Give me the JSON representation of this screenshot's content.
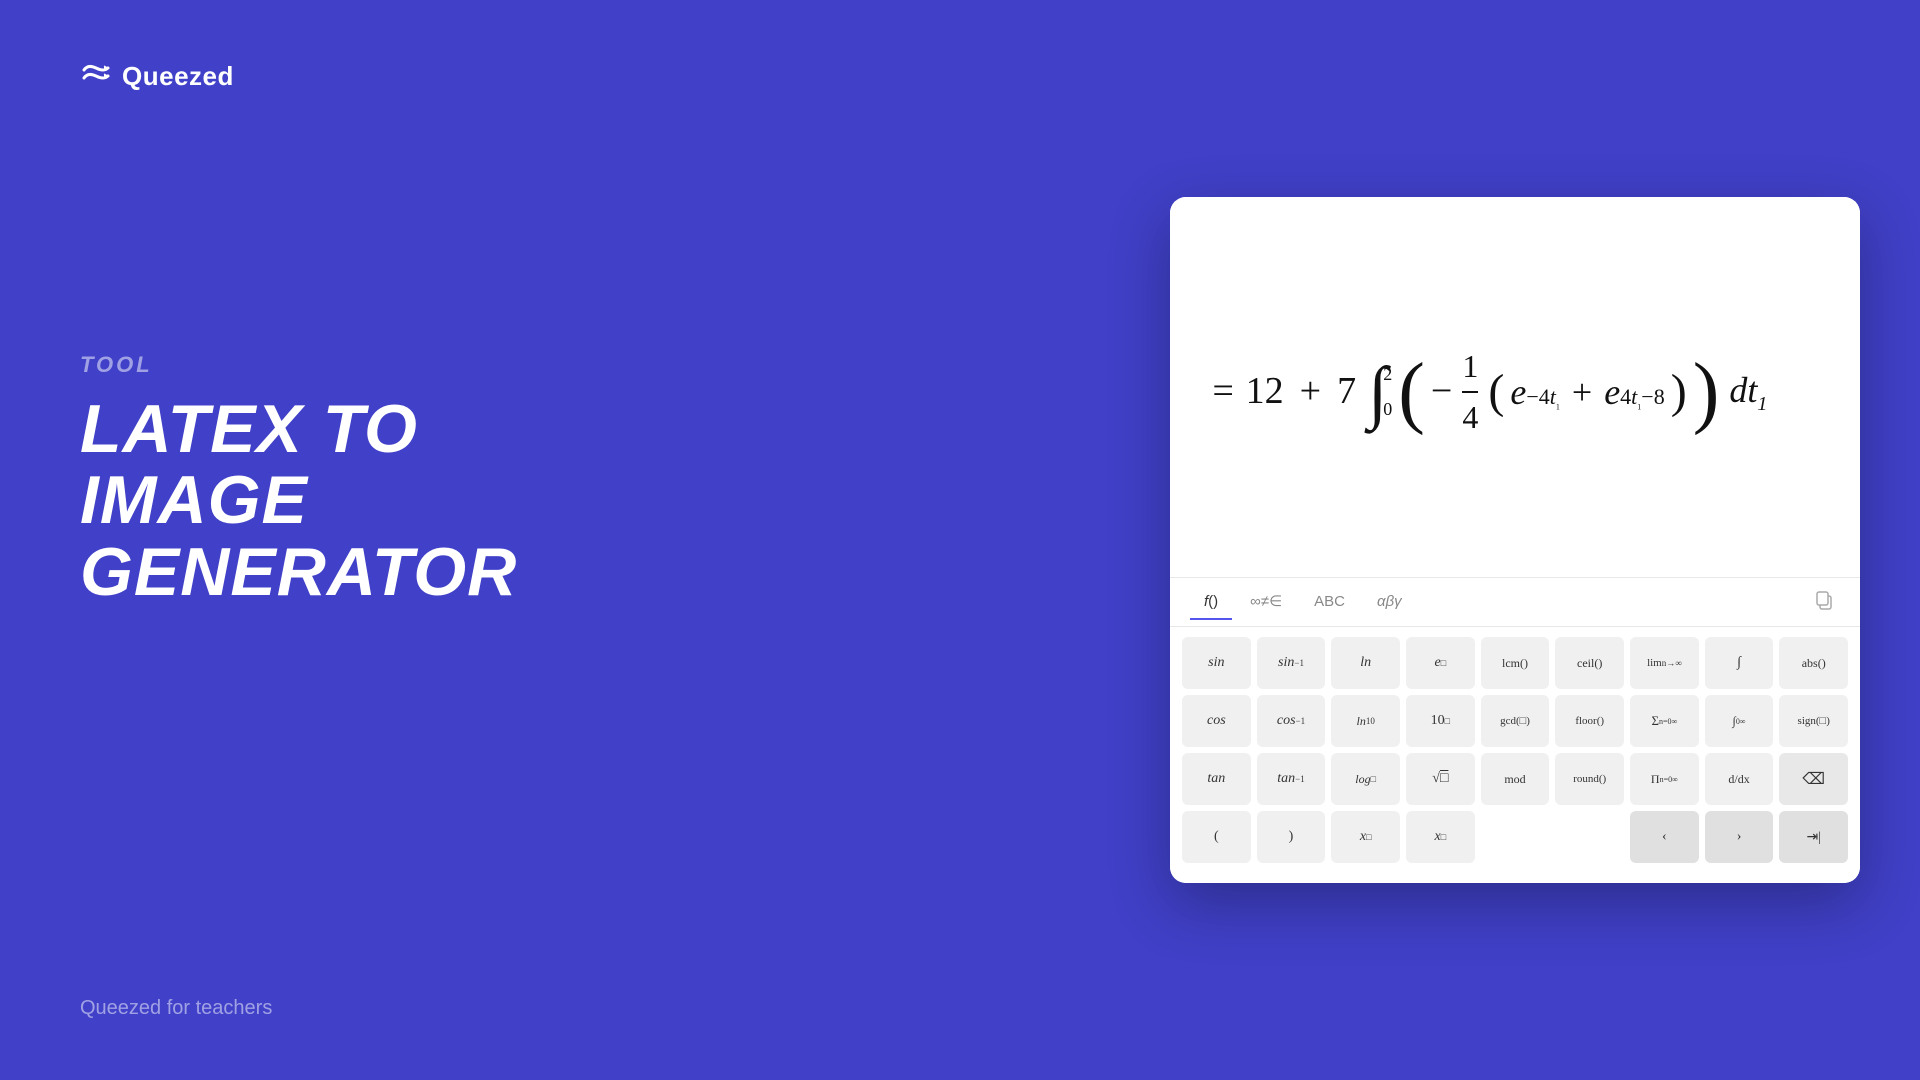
{
  "logo": {
    "text": "Queezed"
  },
  "left": {
    "tool_label": "TOOL",
    "title_line1": "LATEX TO IMAGE",
    "title_line2": "GENERATOR",
    "tagline": "Queezed for teachers"
  },
  "tabs": [
    {
      "label": "f()",
      "active": true
    },
    {
      "label": "∞≠∈",
      "active": false
    },
    {
      "label": "ABC",
      "active": false
    },
    {
      "label": "αβγ",
      "active": false
    }
  ],
  "keyboard": {
    "rows": [
      [
        {
          "label": "sin",
          "type": "func"
        },
        {
          "label": "sin⁻¹",
          "type": "func"
        },
        {
          "label": "ln",
          "type": "func"
        },
        {
          "label": "eˢ",
          "type": "func"
        },
        {
          "label": "lcm()",
          "type": "func"
        },
        {
          "label": "ceil()",
          "type": "func"
        },
        {
          "label": "lim n→∞",
          "type": "func"
        },
        {
          "label": "∫",
          "type": "func"
        },
        {
          "label": "abs()",
          "type": "func"
        }
      ],
      [
        {
          "label": "cos",
          "type": "func"
        },
        {
          "label": "cos⁻¹",
          "type": "func"
        },
        {
          "label": "ln₁₀",
          "type": "func"
        },
        {
          "label": "10ˢ",
          "type": "func"
        },
        {
          "label": "gcd(□)",
          "type": "func"
        },
        {
          "label": "floor()",
          "type": "func"
        },
        {
          "label": "Σ n=0 ∞",
          "type": "func"
        },
        {
          "label": "∫₀^∞",
          "type": "func"
        },
        {
          "label": "sign(□)",
          "type": "func"
        }
      ],
      [
        {
          "label": "tan",
          "type": "func"
        },
        {
          "label": "tan⁻¹",
          "type": "func"
        },
        {
          "label": "log□",
          "type": "func"
        },
        {
          "label": "√□",
          "type": "func"
        },
        {
          "label": "mod",
          "type": "func"
        },
        {
          "label": "round()",
          "type": "func"
        },
        {
          "label": "Π n=0 ∞",
          "type": "func"
        },
        {
          "label": "d/dx",
          "type": "func"
        },
        {
          "label": "⌫",
          "type": "action"
        }
      ],
      [
        {
          "label": "(",
          "type": "func"
        },
        {
          "label": ")",
          "type": "func"
        },
        {
          "label": "x□",
          "type": "func"
        },
        {
          "label": "x□",
          "type": "func"
        },
        {
          "label": "",
          "type": "empty"
        },
        {
          "label": "",
          "type": "empty"
        },
        {
          "label": "‹",
          "type": "nav"
        },
        {
          "label": "›",
          "type": "nav"
        },
        {
          "label": "⇥|",
          "type": "nav"
        }
      ]
    ]
  },
  "formula": {
    "display": "= 12 + 7 ∫₀² ( -1/4 (e^{-4t₁} + e^{4t₁-8}) ) dt₁"
  },
  "colors": {
    "background": "#4545cc",
    "card_bg": "#ffffff",
    "active_tab": "#5555ee",
    "key_bg": "#f0f0f0",
    "nav_key_bg": "#e0e0e0"
  }
}
